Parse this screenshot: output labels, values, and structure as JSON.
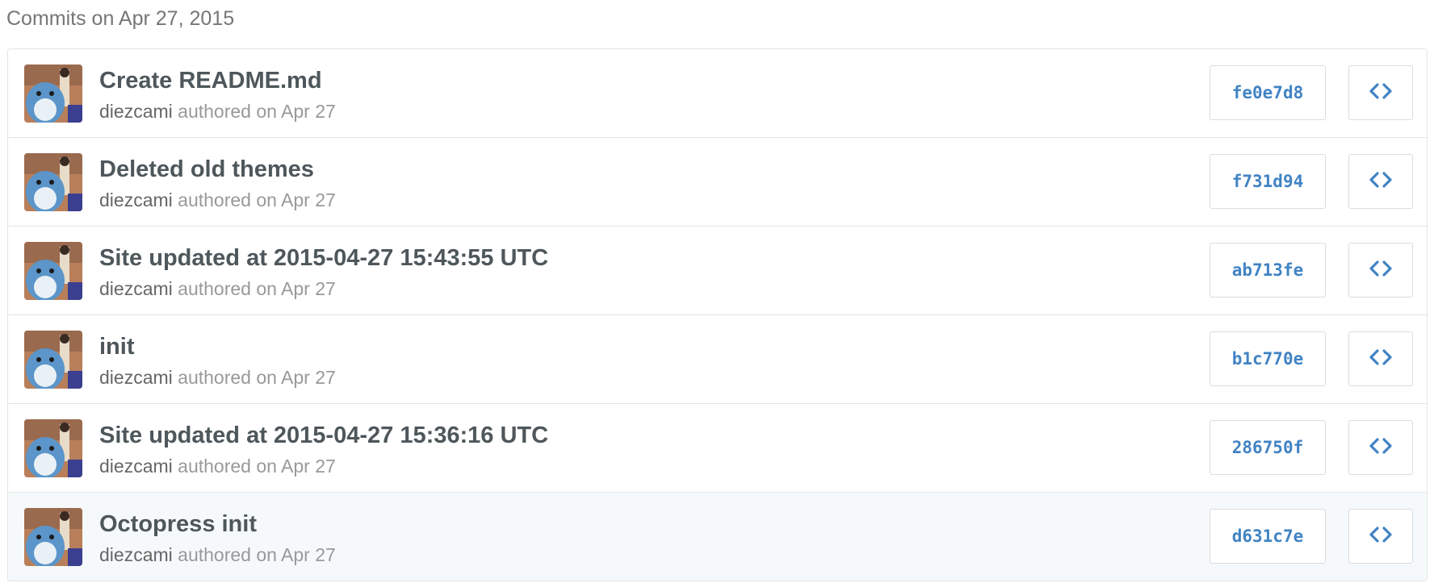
{
  "group": {
    "title": "Commits on Apr 27, 2015"
  },
  "commits": [
    {
      "message": "Create README.md",
      "author": "diezcami",
      "authored_text": " authored on Apr 27",
      "sha": "fe0e7d8",
      "browse_icon": "code-icon"
    },
    {
      "message": "Deleted old themes",
      "author": "diezcami",
      "authored_text": " authored on Apr 27",
      "sha": "f731d94",
      "browse_icon": "code-icon"
    },
    {
      "message": "Site updated at 2015-04-27 15:43:55 UTC",
      "author": "diezcami",
      "authored_text": " authored on Apr 27",
      "sha": "ab713fe",
      "browse_icon": "code-icon"
    },
    {
      "message": "init",
      "author": "diezcami",
      "authored_text": " authored on Apr 27",
      "sha": "b1c770e",
      "browse_icon": "code-icon"
    },
    {
      "message": "Site updated at 2015-04-27 15:36:16 UTC",
      "author": "diezcami",
      "authored_text": " authored on Apr 27",
      "sha": "286750f",
      "browse_icon": "code-icon"
    },
    {
      "message": "Octopress init",
      "author": "diezcami",
      "authored_text": " authored on Apr 27",
      "sha": "d631c7e",
      "browse_icon": "code-icon"
    }
  ],
  "colors": {
    "link": "#4183c4",
    "title": "#4e575b",
    "muted": "#999999",
    "highlight_row": "#f5f9fb"
  }
}
